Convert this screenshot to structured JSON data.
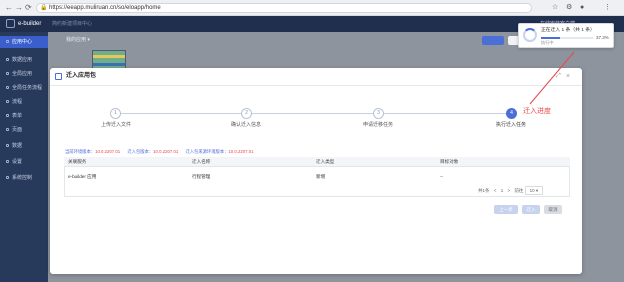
{
  "browser": {
    "back": "←",
    "forward": "→",
    "reload": "⟳",
    "url": "https://eeapp.muliruan.cn/so/eloapp/home"
  },
  "header": {
    "app_name": "e-builder",
    "subtitle": "简约新建项目中心",
    "user": "在线安装客户端"
  },
  "sidebar": {
    "items": [
      {
        "label": "应用中心",
        "active": true
      },
      {
        "label": "数据应用",
        "active": false
      },
      {
        "label": "全局应用",
        "active": false
      },
      {
        "label": "全局任务流程",
        "active": false
      },
      {
        "label": "流程",
        "active": false
      },
      {
        "label": "表单",
        "active": false
      },
      {
        "label": "页面",
        "active": false
      },
      {
        "label": "数据",
        "active": false
      },
      {
        "label": "设置",
        "active": false
      },
      {
        "label": "系统控制",
        "active": false
      }
    ]
  },
  "main": {
    "tab": "我的应用 ▾"
  },
  "modal": {
    "title": "迁入应用包",
    "expand_icon": "⤢",
    "close_icon": "×",
    "steps": [
      {
        "num": "1",
        "label": "上传迁入文件",
        "active": false
      },
      {
        "num": "2",
        "label": "确认迁入信息",
        "active": false
      },
      {
        "num": "3",
        "label": "申请迁移任务",
        "active": false
      },
      {
        "num": "4",
        "label": "执行迁入任务",
        "active": true
      }
    ],
    "callout": "迁入进度",
    "env": [
      {
        "key": "当前环境版本：",
        "value": "10.0.2207.01"
      },
      {
        "key": "迁入包版本：",
        "value": "10.0.2207.01"
      },
      {
        "key": "迁入包来源环境版本：",
        "value": "10.0.2207.01"
      }
    ],
    "columns": [
      "关联服务",
      "迁入名称",
      "迁入类型",
      "目标对象"
    ],
    "rows": [
      [
        "e-builder 应用",
        "行程管理",
        "新增",
        "--"
      ]
    ],
    "pager": {
      "total": "共1条",
      "prev": "<",
      "page": "1",
      "next": ">",
      "jump": "前往",
      "size": "10 ▾"
    },
    "buttons": {
      "prev": "上一步",
      "finish": "迁入",
      "close": "取消"
    }
  },
  "progress": {
    "title": "正在迁入 1 条（共 1 条）",
    "percent": "37.3%",
    "percent_value": 0.373,
    "status": "执行中"
  },
  "colors": {
    "accent": "#4b6fd6",
    "highlight": "#e8484a",
    "header_bg": "#1f2f4d",
    "sidebar_bg": "#283a5c"
  }
}
